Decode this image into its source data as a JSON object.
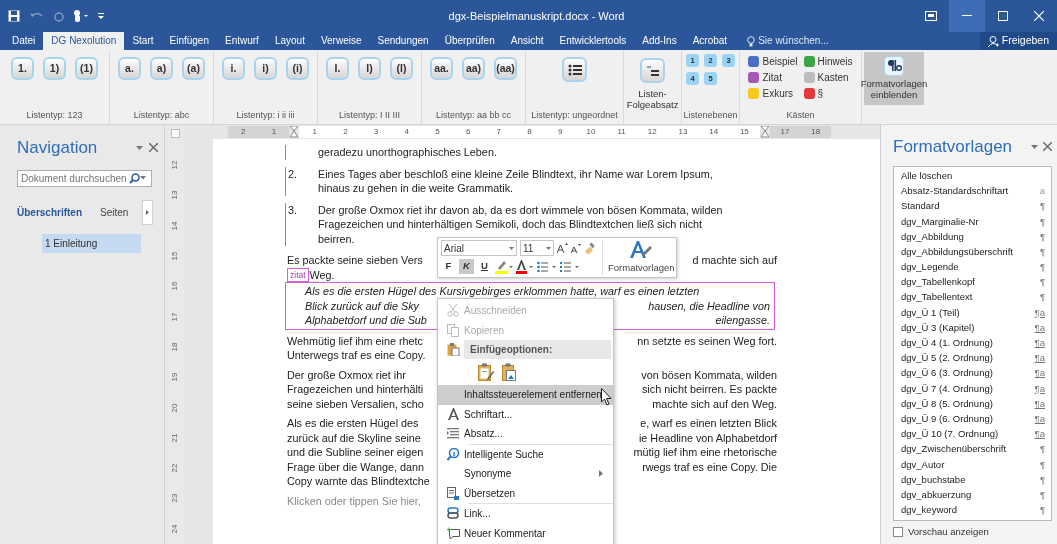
{
  "window": {
    "title": "dgx-Beispielmanuskript.docx - Word"
  },
  "ribbon_tabs": [
    {
      "label": "Datei",
      "selected": false
    },
    {
      "label": "DG Nexolution",
      "selected": true
    },
    {
      "label": "Start",
      "selected": false
    },
    {
      "label": "Einfügen",
      "selected": false
    },
    {
      "label": "Entwurf",
      "selected": false
    },
    {
      "label": "Layout",
      "selected": false
    },
    {
      "label": "Verweise",
      "selected": false
    },
    {
      "label": "Sendungen",
      "selected": false
    },
    {
      "label": "Überprüfen",
      "selected": false
    },
    {
      "label": "Ansicht",
      "selected": false
    },
    {
      "label": "Entwicklertools",
      "selected": false
    },
    {
      "label": "Add-Ins",
      "selected": false
    },
    {
      "label": "Acrobat",
      "selected": false
    }
  ],
  "tell_me": {
    "placeholder": "Sie wünschen..."
  },
  "share_button": "Freigeben",
  "ribbon_groups": [
    {
      "kind": "list_types",
      "label": "Listentyp: 123",
      "buttons": [
        "1.",
        "1)",
        "(1)"
      ]
    },
    {
      "kind": "list_types",
      "label": "Listentyp: abc",
      "buttons": [
        "a.",
        "a)",
        "(a)"
      ]
    },
    {
      "kind": "list_types",
      "label": "Listentyp: i ii iii",
      "buttons": [
        "i.",
        "i)",
        "(i)"
      ]
    },
    {
      "kind": "list_types",
      "label": "Listentyp: I II III",
      "buttons": [
        "I.",
        "I)",
        "(I)"
      ]
    },
    {
      "kind": "list_types",
      "label": "Listentyp: aa bb cc",
      "buttons": [
        "aa.",
        "aa)",
        "(aa)"
      ]
    },
    {
      "kind": "bullets",
      "label": "Listentyp: ungeordnet"
    },
    {
      "kind": "big_button",
      "button": "Listen-Folgeabsatz"
    },
    {
      "kind": "levels",
      "label": "Listenebenen",
      "buttons": [
        "1",
        "2",
        "3",
        "4",
        "5"
      ]
    },
    {
      "kind": "boxes",
      "label": "Kästen",
      "items": [
        {
          "label": "Beispiel",
          "color": "#4a6fc4"
        },
        {
          "label": "Hinweis",
          "color": "#3aa345"
        },
        {
          "label": "Zitat",
          "color": "#a557b3"
        },
        {
          "label": "Kasten",
          "color": "#bcbcbc"
        },
        {
          "label": "Exkurs",
          "color": "#f7c81e"
        },
        {
          "label": "§",
          "color": "#e23b3b"
        }
      ]
    },
    {
      "kind": "toggle",
      "button": "Formatvorlagen einblenden",
      "selected": true
    }
  ],
  "navigation": {
    "title": "Navigation",
    "search": {
      "placeholder": "Dokument durchsuchen"
    },
    "tabs": [
      {
        "label": "Überschriften",
        "selected": true
      },
      {
        "label": "Seiten",
        "selected": false
      }
    ],
    "headings": [
      {
        "label": "1 Einleitung",
        "selected": true
      }
    ]
  },
  "rulers": {
    "horizontal": [
      {
        "label": "2",
        "kind": "margin"
      },
      {
        "label": "1",
        "kind": "margin"
      },
      {
        "label": "1",
        "kind": "text"
      },
      {
        "label": "2",
        "kind": "text"
      },
      {
        "label": "3",
        "kind": "text"
      },
      {
        "label": "4",
        "kind": "text"
      },
      {
        "label": "5",
        "kind": "text"
      },
      {
        "label": "6",
        "kind": "text"
      },
      {
        "label": "7",
        "kind": "text"
      },
      {
        "label": "8",
        "kind": "text"
      },
      {
        "label": "9",
        "kind": "text"
      },
      {
        "label": "10",
        "kind": "text"
      },
      {
        "label": "11",
        "kind": "text"
      },
      {
        "label": "12",
        "kind": "text"
      },
      {
        "label": "13",
        "kind": "text"
      },
      {
        "label": "14",
        "kind": "text"
      },
      {
        "label": "15",
        "kind": "text"
      },
      {
        "label": "17",
        "kind": "margin"
      },
      {
        "label": "18",
        "kind": "margin"
      }
    ],
    "vertical": [
      "12",
      "13",
      "14",
      "15",
      "16",
      "17",
      "18",
      "19",
      "20",
      "21",
      "22",
      "23",
      "24"
    ]
  },
  "document": [
    {
      "kind": "list_item",
      "lines": [
        [
          "geradezu unorthographisches Leben."
        ]
      ]
    },
    {
      "kind": "list_item",
      "number": "2.",
      "lines": [
        [
          "Eines Tages aber beschloß eine kleine Zeile Blindtext, ihr Name war Lorem Ipsum,"
        ],
        [
          "hinaus zu gehen in die weite Grammatik."
        ]
      ]
    },
    {
      "kind": "list_item",
      "number": "3.",
      "lines": [
        [
          "Der große Oxmox riet ihr davon ab, da es dort wimmele von bösen Kommata, wilden"
        ],
        [
          "Fragezeichen und hinterhältigen Semikoli, doch das Blindtextchen ließ sich nicht"
        ],
        [
          "beirren."
        ]
      ]
    },
    {
      "kind": "body",
      "lines": [
        [
          "Es packte seine sieben Vers",
          "d machte sich auf"
        ],
        [
          "Weg."
        ]
      ],
      "tag": "zitat"
    },
    {
      "kind": "quote",
      "lines": [
        [
          "Als es die ersten Hügel des Kursivgebirges erklommen hatte, warf es einen letzten"
        ],
        [
          "Blick zurück auf die Sky",
          "hausen, die Headline von"
        ],
        [
          "Alphabetdorf und die Sub",
          "eilengasse."
        ]
      ]
    },
    {
      "kind": "body",
      "lines": [
        [
          "Wehmütig lief ihm eine rhetc",
          "nn setzte es seinen Weg fort."
        ],
        [
          "Unterwegs traf es eine Copy."
        ]
      ]
    },
    {
      "kind": "body",
      "lines": [
        [
          "Der große Oxmox riet ihr",
          "von bösen Kommata, wilden"
        ],
        [
          "Fragezeichen und hinterhälti",
          "sich nicht beirren. Es packte"
        ],
        [
          "seine sieben Versalien, scho",
          "machte sich auf den Weg."
        ]
      ]
    },
    {
      "kind": "body",
      "lines": [
        [
          "Als es die ersten Hügel des",
          "e, warf es einen letzten Blick"
        ],
        [
          "zurück auf die Skyline seine",
          "ie Headline von Alphabetdorf"
        ],
        [
          "und die Subline seiner eigen",
          "mütig lief ihm eine rhetorische"
        ],
        [
          "Frage über die Wange, dann",
          "rwegs traf es eine Copy. Die"
        ],
        [
          "Copy warnte das Blindtextche"
        ]
      ]
    },
    {
      "kind": "placeholder",
      "lines": [
        [
          "Klicken oder tippen Sie hier,"
        ]
      ]
    }
  ],
  "mini_toolbar": {
    "font": "Arial",
    "size": "11",
    "format_buttons": [
      {
        "label": "F",
        "selected": false
      },
      {
        "label": "K",
        "selected": true
      },
      {
        "label": "U",
        "selected": false
      }
    ],
    "styles_button": "Formatvorlagen"
  },
  "context_menu": [
    {
      "kind": "item",
      "label": "Ausschneiden",
      "disabled": true,
      "selected": false
    },
    {
      "kind": "item",
      "label": "Kopieren",
      "disabled": true,
      "selected": false
    },
    {
      "kind": "header",
      "label": "Einfügeoptionen:"
    },
    {
      "kind": "paste_options"
    },
    {
      "kind": "item",
      "label": "Inhaltssteuerelement entfernen",
      "disabled": false,
      "selected": true
    },
    {
      "kind": "item",
      "label": "Schriftart...",
      "disabled": false,
      "selected": false
    },
    {
      "kind": "item",
      "label": "Absatz...",
      "disabled": false,
      "selected": false
    },
    {
      "kind": "item",
      "label": "Intelligente Suche",
      "disabled": false,
      "selected": false,
      "separator": true
    },
    {
      "kind": "item",
      "label": "Synonyme",
      "disabled": false,
      "selected": false,
      "submenu": true
    },
    {
      "kind": "item",
      "label": "Übersetzen",
      "disabled": false,
      "selected": false
    },
    {
      "kind": "item",
      "label": "Link...",
      "disabled": false,
      "selected": false,
      "separator": true
    },
    {
      "kind": "item",
      "label": "Neuer Kommentar",
      "disabled": false,
      "selected": false
    }
  ],
  "styles_pane": {
    "title": "Formatvorlagen",
    "styles": [
      {
        "label": "Alle löschen"
      },
      {
        "label": "Absatz-Standardschriftart",
        "kind": "character",
        "symbol": "a"
      },
      {
        "label": "Standard",
        "kind": "paragraph",
        "symbol": "¶"
      },
      {
        "label": "dgv_Marginalie-Nr",
        "kind": "paragraph",
        "symbol": "¶"
      },
      {
        "label": "dgv_Abbildung",
        "kind": "paragraph",
        "symbol": "¶"
      },
      {
        "label": "dgv_Abbildungsüberschrift",
        "kind": "paragraph",
        "symbol": "¶"
      },
      {
        "label": "dgv_Legende",
        "kind": "paragraph",
        "symbol": "¶"
      },
      {
        "label": "dgv_Tabellenkopf",
        "kind": "paragraph",
        "symbol": "¶"
      },
      {
        "label": "dgv_Tabellentext",
        "kind": "paragraph",
        "symbol": "¶"
      },
      {
        "label": "dgv_Ü 1 (Teil)",
        "kind": "linked",
        "symbol": "¶a"
      },
      {
        "label": "dgv_Ü 3 (Kapitel)",
        "kind": "linked",
        "symbol": "¶a"
      },
      {
        "label": "dgv_Ü 4 (1. Ordnung)",
        "kind": "linked",
        "symbol": "¶a"
      },
      {
        "label": "dgv_Ü 5 (2. Ordnung)",
        "kind": "linked",
        "symbol": "¶a"
      },
      {
        "label": "dgv_Ü 6 (3. Ordnung)",
        "kind": "linked",
        "symbol": "¶a"
      },
      {
        "label": "dgv_Ü 7 (4. Ordnung)",
        "kind": "linked",
        "symbol": "¶a"
      },
      {
        "label": "dgv_Ü 8 (5. Ordnung)",
        "kind": "linked",
        "symbol": "¶a"
      },
      {
        "label": "dgv_Ü 9 (6. Ordnung)",
        "kind": "linked",
        "symbol": "¶a"
      },
      {
        "label": "dgv_Ü 10 (7. Ordnung)",
        "kind": "linked",
        "symbol": "¶a"
      },
      {
        "label": "dgv_Zwischenüberschrift",
        "kind": "paragraph",
        "symbol": "¶"
      },
      {
        "label": "dgv_Autor",
        "kind": "paragraph",
        "symbol": "¶"
      },
      {
        "label": "dgv_buchstabe",
        "kind": "paragraph",
        "symbol": "¶"
      },
      {
        "label": "dgv_abkuerzung",
        "kind": "paragraph",
        "symbol": "¶"
      },
      {
        "label": "dgv_keyword",
        "kind": "paragraph",
        "symbol": "¶"
      }
    ],
    "preview": {
      "label": "Vorschau anzeigen",
      "checked": false
    }
  }
}
